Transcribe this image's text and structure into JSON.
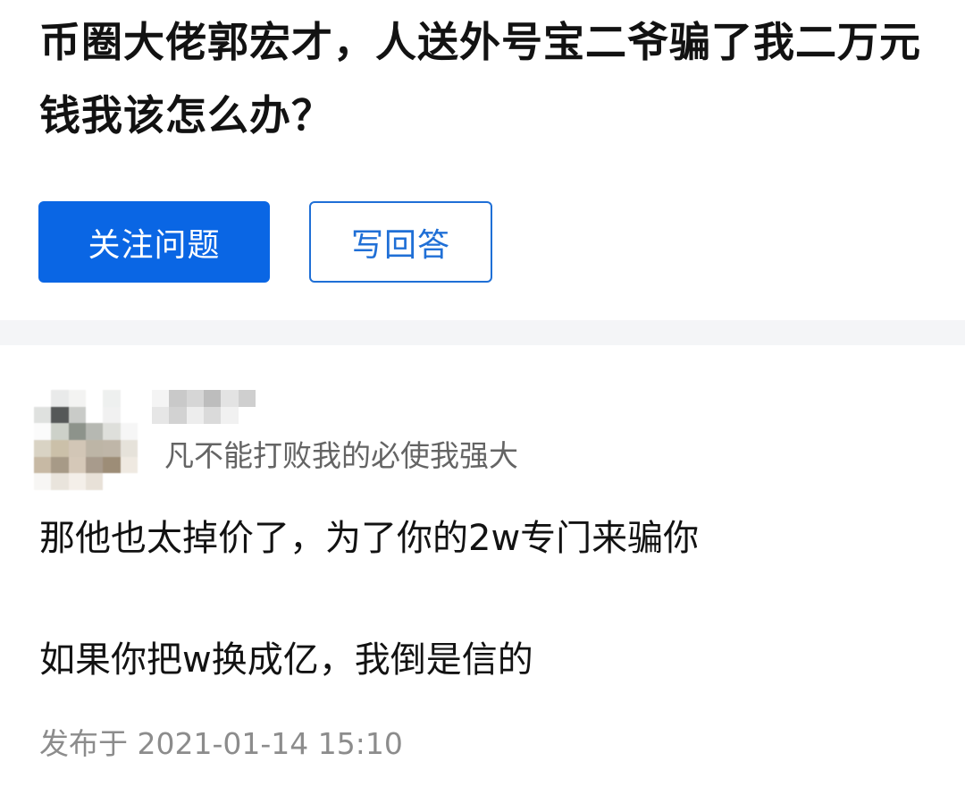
{
  "question": {
    "title": "币圈大佬郭宏才，人送外号宝二爷骗了我二万元钱我该怎么办？",
    "follow_label": "关注问题",
    "answer_label": "写回答",
    "colors": {
      "primary": "#0a66e4",
      "outline": "#1f6fd6"
    }
  },
  "answer": {
    "author": {
      "avatar_icon": "pixelated-avatar-icon",
      "name_icon": "pixelated-name-icon",
      "bio": "凡不能打败我的必使我强大"
    },
    "content": {
      "line1": "那他也太掉价了，为了你的2w专门来骗你",
      "line2": "如果你把w换成亿，我倒是信的"
    },
    "publish_time": "发布于 2021-01-14 15:10"
  }
}
